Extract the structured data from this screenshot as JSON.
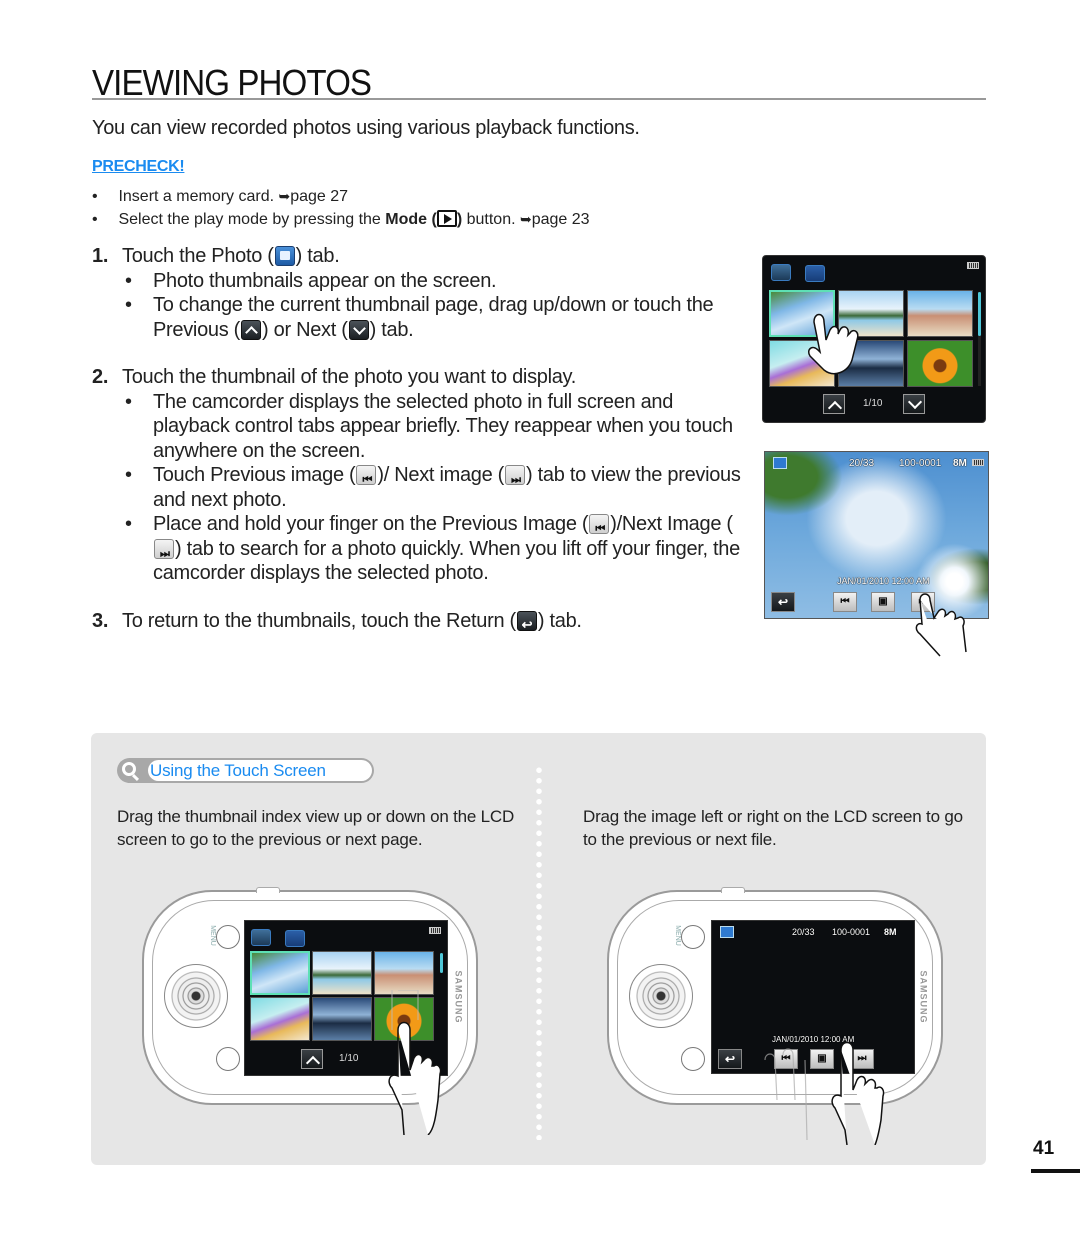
{
  "page": {
    "title": "VIEWING PHOTOS",
    "intro": "You can view recorded photos using various playback functions.",
    "page_number": "41"
  },
  "precheck": {
    "heading": "PRECHECK!",
    "items": [
      {
        "text": "Insert a memory card. ",
        "ref": "page 27"
      },
      {
        "text_before": "Select the play mode by pressing the ",
        "bold": "Mode (",
        "bold_after": ")",
        "text_after": " button. ",
        "ref": "page 23"
      }
    ]
  },
  "steps": [
    {
      "num": "1.",
      "parts": [
        "Touch the Photo (",
        ") tab."
      ],
      "icon": "photo-tab-icon",
      "bullets": [
        {
          "text": "Photo thumbnails appear on the screen."
        },
        {
          "parts": [
            "To change the current thumbnail page, drag up/down or touch the Previous (",
            ") or Next (",
            ") tab."
          ]
        }
      ]
    },
    {
      "num": "2.",
      "text": "Touch the thumbnail of the photo you want to display.",
      "bullets": [
        {
          "text": "The camcorder displays the selected photo in full screen and playback control tabs appear briefly. They reappear when you touch anywhere on the screen."
        },
        {
          "parts": [
            "Touch Previous image (",
            ")/ Next image (",
            ") tab to view the previous and next photo."
          ]
        },
        {
          "parts": [
            "Place and hold your finger on the Previous Image (",
            ")/Next Image (",
            ") tab to search for a photo quickly. When you lift off your finger, the camcorder displays the selected photo."
          ]
        }
      ]
    },
    {
      "num": "3.",
      "parts": [
        "To return to the thumbnails, touch the Return (",
        ") tab."
      ]
    }
  ],
  "icons": {
    "arrow": "➥",
    "prev_image": "⏮",
    "next_image": "⏭",
    "return": "↩",
    "play": "▣"
  },
  "thumbnail_screen": {
    "page_counter": "1/10"
  },
  "photo_screen": {
    "counter": "20/33",
    "file_number": "100-0001",
    "resolution": "8M",
    "datetime": "JAN/01/2010  12:00 AM"
  },
  "tip": {
    "label": "Using the Touch Screen",
    "left_text": "Drag the thumbnail index view up or down on the LCD screen to go to the previous or next page.",
    "right_text": "Drag the image left or right on the LCD screen to go to the previous or next file."
  },
  "device": {
    "menu_label": "MENU",
    "brand": "SAMSUNG",
    "page_counter": "1/10",
    "counter": "20/33",
    "file_number": "100-0001",
    "resolution": "8M",
    "datetime": "JAN/01/2010  12:00 AM"
  },
  "colors": {
    "accent_blue": "#1a8bf0",
    "tip_background": "#e6e6e6",
    "selected_thumb": "#5ee0b5"
  }
}
